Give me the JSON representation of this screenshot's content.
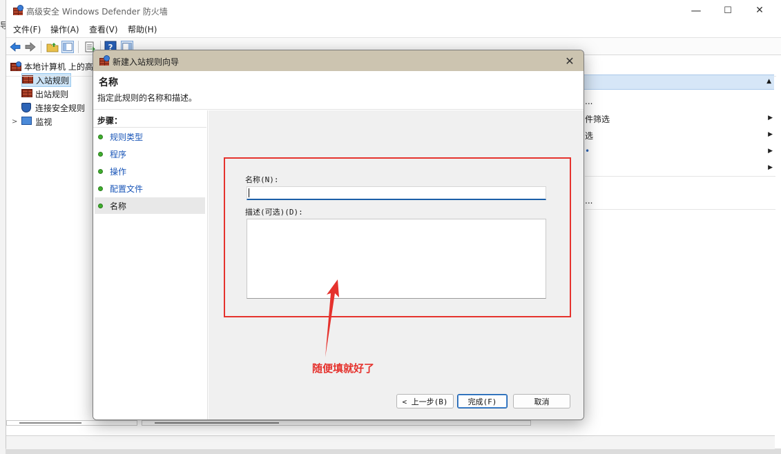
{
  "window": {
    "title": "高级安全 Windows Defender 防火墙",
    "controls": [
      "—",
      "☐",
      "✕"
    ]
  },
  "menu": [
    "文件(F)",
    "操作(A)",
    "查看(V)",
    "帮助(H)"
  ],
  "tree": {
    "root": "本地计算机 上的高",
    "items": [
      "入站规则",
      "出站规则",
      "连接安全规则",
      "监视"
    ]
  },
  "right_pane": {
    "rows": [
      "...",
      "件筛选",
      "选",
      "•",
      "",
      "..."
    ]
  },
  "dialog": {
    "title": "新建入站规则向导",
    "heading": "名称",
    "subheading": "指定此规则的名称和描述。",
    "steps_label": "步骤：",
    "steps": [
      "规则类型",
      "程序",
      "操作",
      "配置文件",
      "名称"
    ],
    "name_label": "名称(N):",
    "name_value": "",
    "description_label": "描述(可选)(D):",
    "description_value": "",
    "buttons": {
      "back": "< 上一步(B)",
      "finish": "完成(F)",
      "cancel": "取消"
    }
  },
  "annotation": {
    "text": "随便填就好了",
    "color": "#e5322d"
  },
  "edge_text": {
    "left_top": "导"
  }
}
